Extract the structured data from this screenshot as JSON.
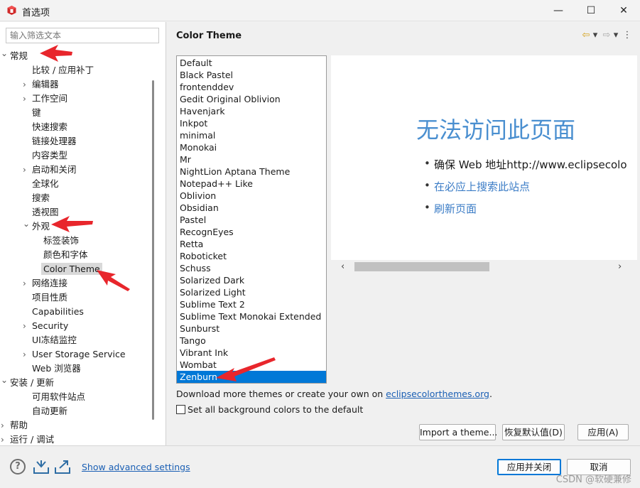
{
  "window": {
    "title": "首选项",
    "minimize": "—",
    "maximize": "☐",
    "close": "✕"
  },
  "filter": {
    "placeholder": "输入筛选文本"
  },
  "tree": [
    {
      "label": "常规",
      "twisty": "expanded"
    },
    {
      "label": "比较 / 应用补丁"
    },
    {
      "label": "编辑器",
      "twisty": "collapsed"
    },
    {
      "label": "工作空间",
      "twisty": "collapsed"
    },
    {
      "label": "键"
    },
    {
      "label": "快速搜索"
    },
    {
      "label": "链接处理器"
    },
    {
      "label": "内容类型"
    },
    {
      "label": "启动和关闭",
      "twisty": "collapsed"
    },
    {
      "label": "全球化"
    },
    {
      "label": "搜索"
    },
    {
      "label": "透视图"
    },
    {
      "label": "外观",
      "twisty": "expanded"
    },
    {
      "label": "标签装饰"
    },
    {
      "label": "颜色和字体"
    },
    {
      "label": "Color Theme",
      "selected": true
    },
    {
      "label": "网络连接",
      "twisty": "collapsed"
    },
    {
      "label": "项目性质"
    },
    {
      "label": "Capabilities"
    },
    {
      "label": "Security",
      "twisty": "collapsed"
    },
    {
      "label": "UI冻结监控"
    },
    {
      "label": "User Storage Service",
      "twisty": "collapsed"
    },
    {
      "label": "Web 浏览器"
    },
    {
      "label": "安装 / 更新",
      "twisty": "expanded"
    },
    {
      "label": "可用软件站点"
    },
    {
      "label": "自动更新"
    },
    {
      "label": "帮助",
      "twisty": "collapsed"
    },
    {
      "label": "运行 / 调试",
      "twisty": "collapsed"
    }
  ],
  "main": {
    "title": "Color Theme",
    "nav": {
      "back": "⇦",
      "back_menu": "▾",
      "forward": "⇨",
      "forward_menu": "▾",
      "more": "⋮"
    },
    "themes": [
      "Default",
      "Black Pastel",
      "frontenddev",
      "Gedit Original Oblivion",
      "Havenjark",
      "Inkpot",
      "minimal",
      "Monokai",
      "Mr",
      "NightLion Aptana Theme",
      "Notepad++ Like",
      "Oblivion",
      "Obsidian",
      "Pastel",
      "RecognEyes",
      "Retta",
      "Roboticket",
      "Schuss",
      "Solarized Dark",
      "Solarized Light",
      "Sublime Text 2",
      "Sublime Text Monokai Extended",
      "Sunburst",
      "Tango",
      "Vibrant Ink",
      "Wombat",
      "Zenburn"
    ],
    "selected_theme": "Zenburn",
    "preview": {
      "heading": "无法访问此页面",
      "bullet1": "确保 Web 地址http://www.eclipsecolo",
      "bullet2": "在必应上搜索此站点",
      "bullet3": "刷新页面",
      "bullet_dot": "•"
    },
    "scroll_left": "‹",
    "scroll_right": "›",
    "download_prefix": "Download more themes or create your own on ",
    "download_link": "eclipsecolorthemes.org",
    "download_suffix": ".",
    "checkbox_label": "Set all background colors to the default",
    "checkbox_checked": false,
    "import_button": "Import a theme...",
    "restore_button": "恢复默认值(D)",
    "apply_button": "应用(A)"
  },
  "bottom": {
    "help": "?",
    "advanced_link": "Show advanced settings",
    "apply_close_button": "应用并关闭",
    "cancel_button": "取消",
    "watermark": "CSDN @软硬兼修"
  },
  "colors": {
    "selection": "#0078d7",
    "link": "#1a5fb4",
    "annotation_arrow": "#e8262c",
    "preview_heading": "#4a8fd0"
  }
}
